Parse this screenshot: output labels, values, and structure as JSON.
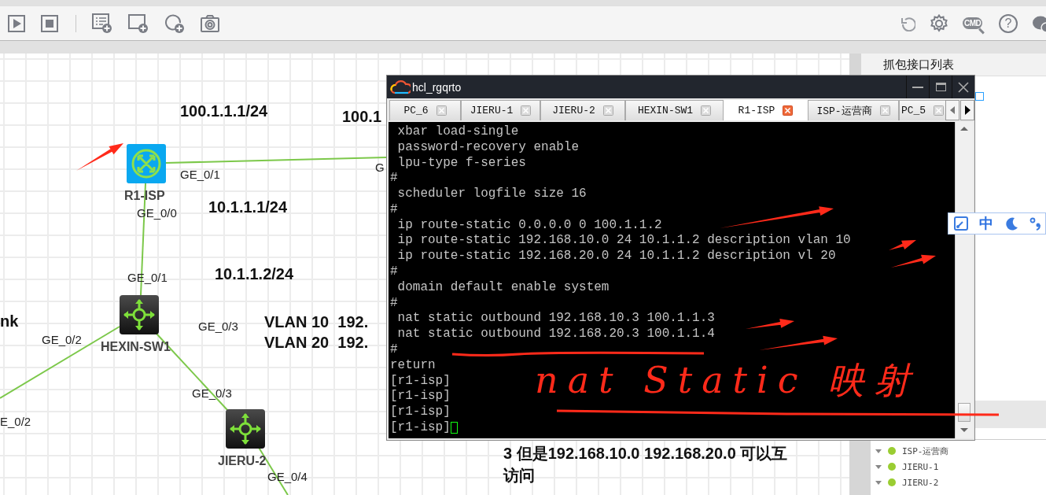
{
  "toolbar": {
    "cmd_label": "CMD",
    "help_glyph": "?"
  },
  "canvas": {
    "labels": [
      {
        "text": "100.1.1.1/24",
        "kind": "ip"
      },
      {
        "text": "100.1",
        "kind": "ip"
      },
      {
        "text": "10.1.1.1/24",
        "kind": "ip"
      },
      {
        "text": "10.1.1.2/24",
        "kind": "ip"
      },
      {
        "text": "VLAN 10  192.",
        "kind": "ip"
      },
      {
        "text": "VLAN 20  192.",
        "kind": "ip"
      },
      {
        "text": "nk",
        "kind": "ip"
      },
      {
        "text": "GE_0/1",
        "kind": "port"
      },
      {
        "text": "G",
        "kind": "port"
      },
      {
        "text": "GE_0/0",
        "kind": "port"
      },
      {
        "text": "GE_0/1",
        "kind": "port"
      },
      {
        "text": "GE_0/3",
        "kind": "port"
      },
      {
        "text": "GE_0/2",
        "kind": "port"
      },
      {
        "text": "E_0/2",
        "kind": "port"
      },
      {
        "text": "GE_0/3",
        "kind": "port"
      },
      {
        "text": "GE_0/4",
        "kind": "port"
      },
      {
        "text": "3 但是192.168.10.0 192.168.20.0 可以互",
        "kind": "note"
      },
      {
        "text": "访问",
        "kind": "note"
      }
    ],
    "nodes": [
      {
        "name": "R1-ISP",
        "kind": "router"
      },
      {
        "name": "HEXIN-SW1",
        "kind": "switch"
      },
      {
        "name": "JIERU-2",
        "kind": "switch"
      }
    ]
  },
  "terminal": {
    "title": "hcl_rgqrto",
    "tabs": [
      {
        "label": "PC_6",
        "selected": false
      },
      {
        "label": "JIERU-1",
        "selected": false
      },
      {
        "label": "JIERU-2",
        "selected": false
      },
      {
        "label": "HEXIN-SW1",
        "selected": false
      },
      {
        "label": "R1-ISP",
        "selected": true
      },
      {
        "label": "ISP-运营商",
        "selected": false
      },
      {
        "label": "PC_5",
        "selected": false
      }
    ],
    "lines": [
      " xbar load-single",
      " password-recovery enable",
      " lpu-type f-series",
      "#",
      " scheduler logfile size 16",
      "#",
      " ip route-static 0.0.0.0 0 100.1.1.2",
      " ip route-static 192.168.10.0 24 10.1.1.2 description vlan 10",
      " ip route-static 192.168.20.0 24 10.1.1.2 description vl 20",
      "#",
      " domain default enable system",
      "#",
      " nat static outbound 192.168.10.3 100.1.1.3",
      " nat static outbound 192.168.20.3 100.1.1.4",
      "#",
      "return",
      "[r1-isp]",
      "[r1-isp]",
      "[r1-isp]",
      "[r1-isp]"
    ],
    "cursor": true
  },
  "capture_panel": {
    "title": "抓包接口列表",
    "devices": [
      {
        "name": "ISP-运营商"
      },
      {
        "name": "JIERU-1"
      },
      {
        "name": "JIERU-2"
      }
    ]
  },
  "ime_bar": {
    "mode": "中"
  },
  "annotation": {
    "text": "nat Static 映射"
  }
}
